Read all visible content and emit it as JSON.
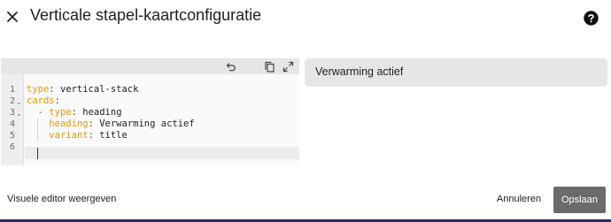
{
  "dialog": {
    "title": "Verticale stapel-kaartconfiguratie",
    "close_icon": "close-icon",
    "help_icon": "help-icon"
  },
  "editor": {
    "toolbar_icons": [
      "undo-icon",
      "copy-icon",
      "fullscreen-icon"
    ],
    "line_numbers": [
      "1",
      "2",
      "3",
      "4",
      "5",
      "6"
    ],
    "fold_markers": [
      "",
      "⌄",
      "⌄",
      "",
      "",
      ""
    ],
    "lines": [
      {
        "indent": "",
        "dash": "",
        "key": "type",
        "colon": ":",
        "value": " vertical-stack"
      },
      {
        "indent": "",
        "dash": "",
        "key": "cards",
        "colon": ":",
        "value": ""
      },
      {
        "indent": "  ",
        "dash": "- ",
        "key": "type",
        "colon": ":",
        "value": " heading"
      },
      {
        "indent": "    ",
        "dash": "",
        "key": "heading",
        "colon": ":",
        "value": " Verwarming actief"
      },
      {
        "indent": "    ",
        "dash": "",
        "key": "variant",
        "colon": ":",
        "value": " title"
      },
      {
        "indent": "",
        "dash": "",
        "key": "",
        "colon": "",
        "value": ""
      }
    ]
  },
  "preview": {
    "heading": "Verwarming actief"
  },
  "footer": {
    "toggle_label": "Visuele editor weergeven",
    "cancel_label": "Annuleren",
    "save_label": "Opslaan"
  },
  "colors": {
    "yaml_key": "#e69a00",
    "save_button": "#6b6b6b",
    "preview_card": "#e6e6e6"
  }
}
